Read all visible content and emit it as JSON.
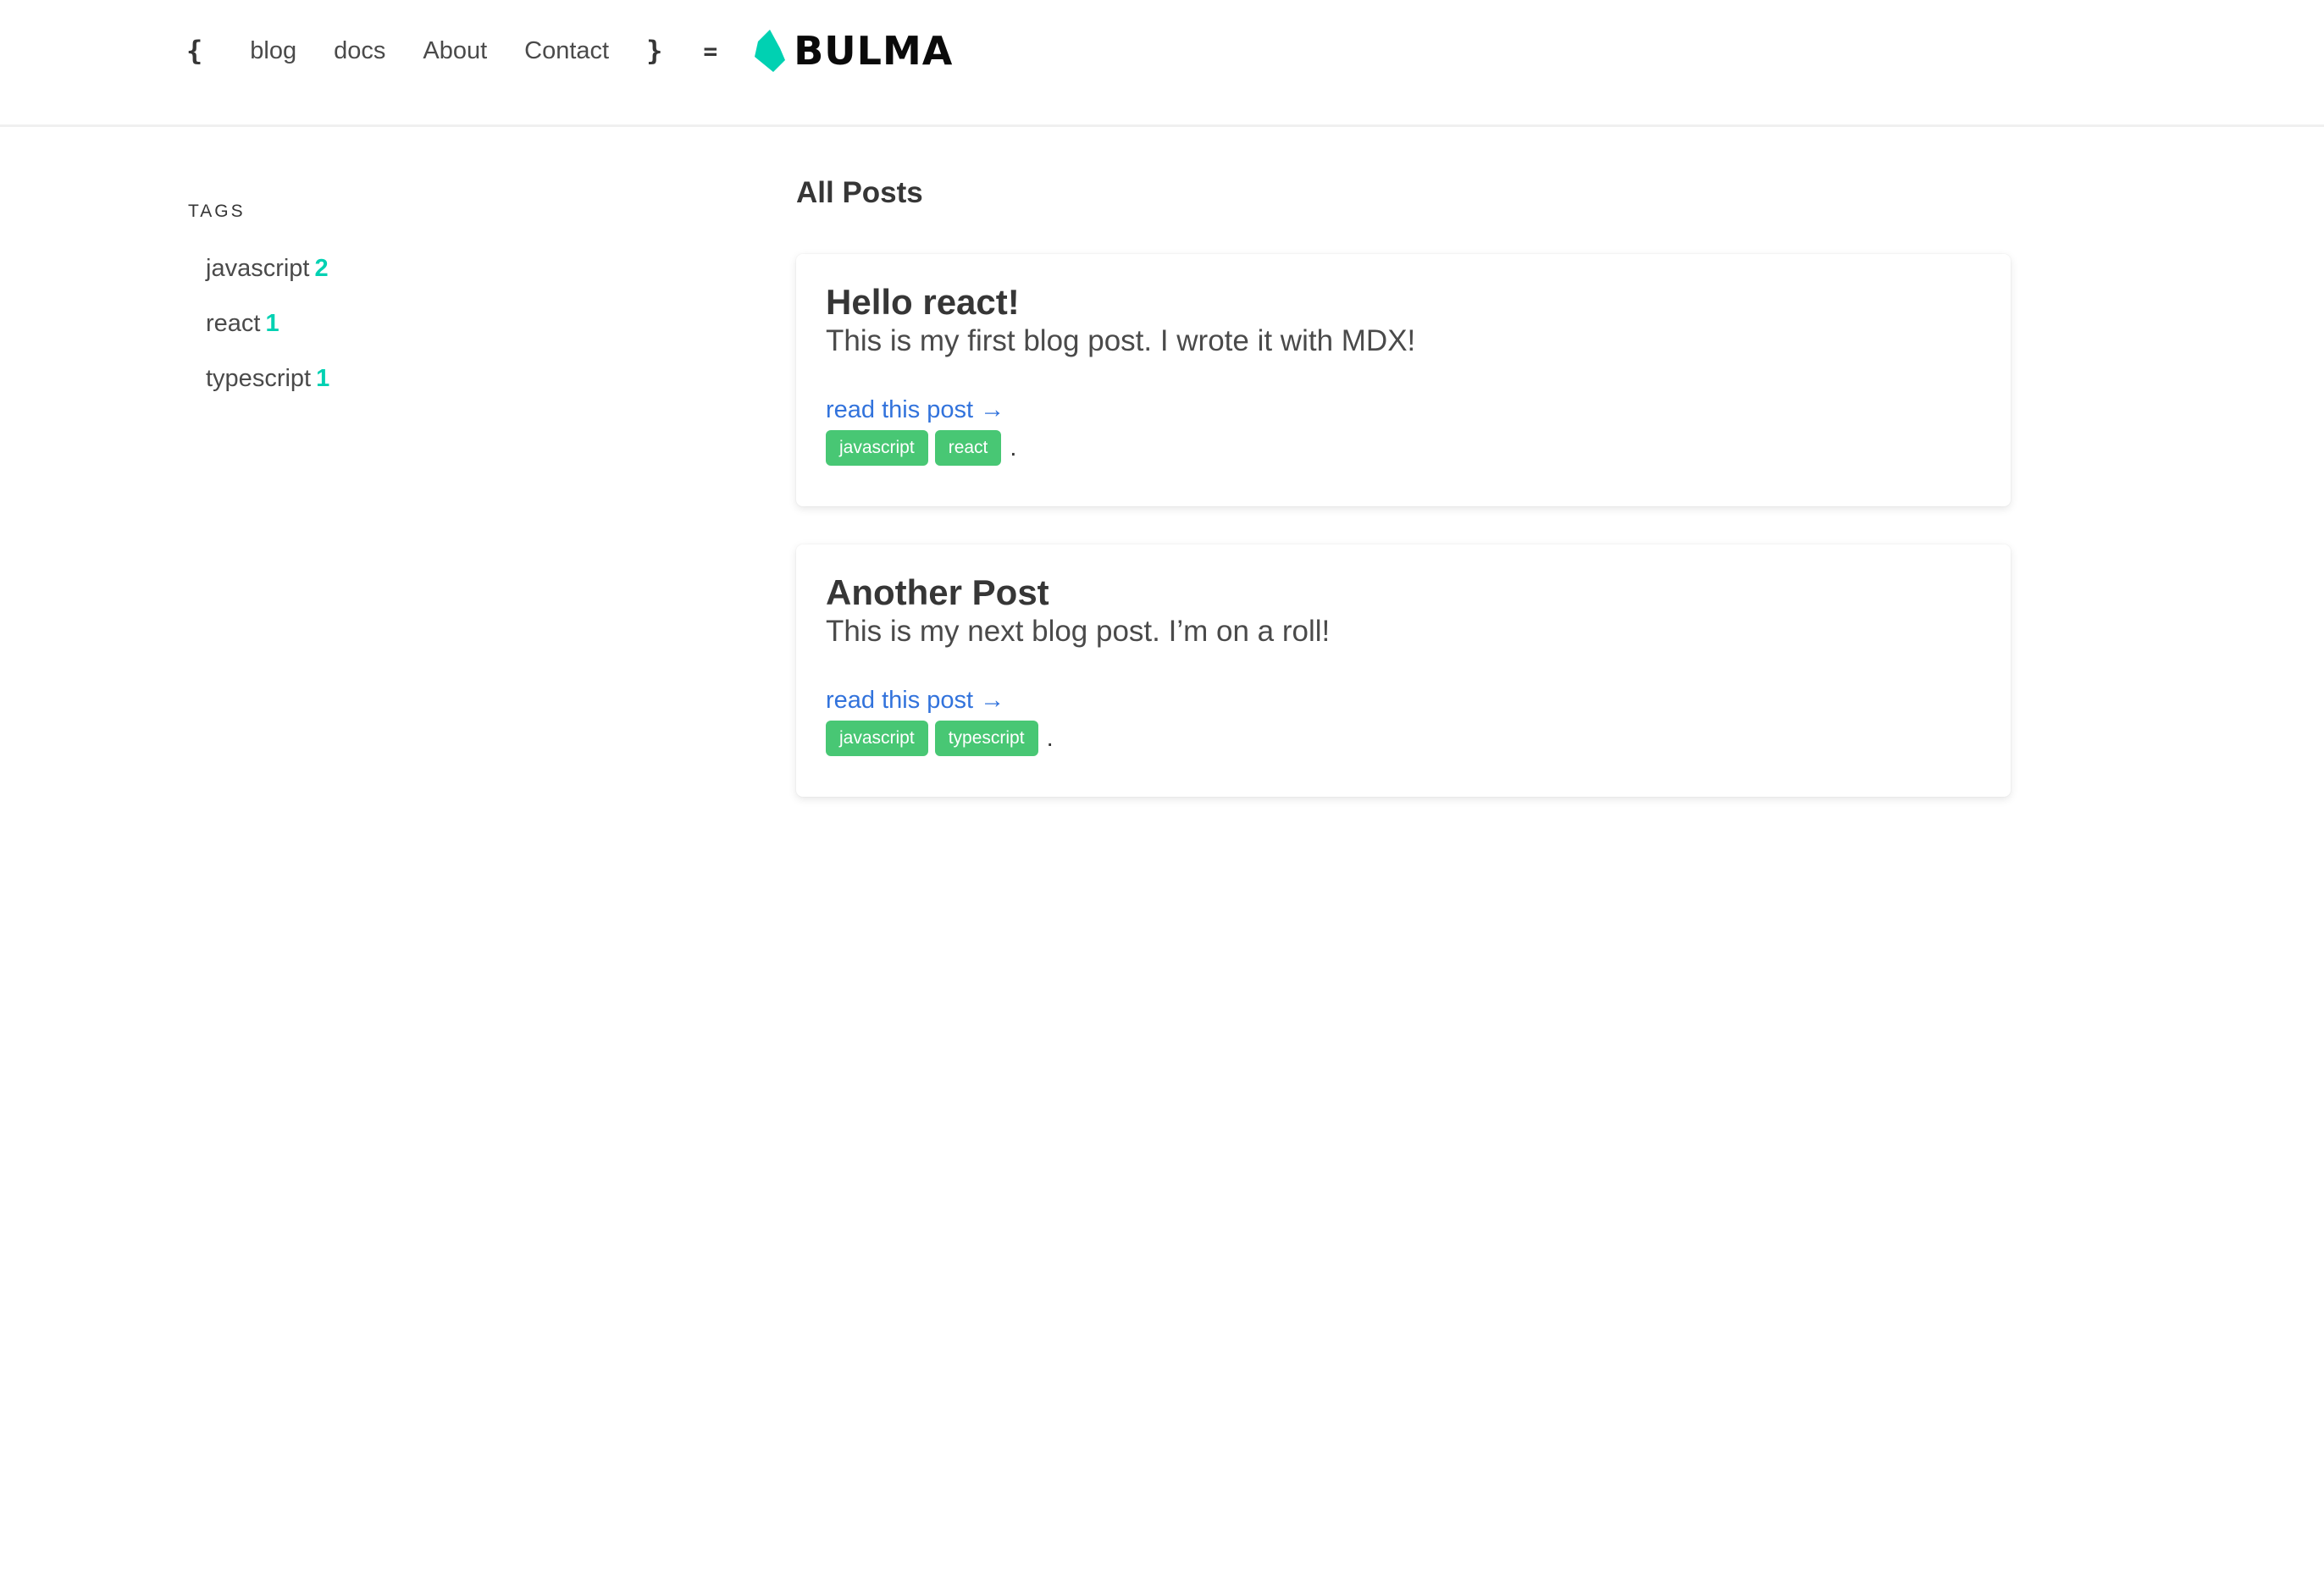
{
  "navbar": {
    "open_brace": "{",
    "close_brace": "}",
    "equals": "=",
    "items": [
      {
        "label": "blog"
      },
      {
        "label": "docs"
      },
      {
        "label": "About"
      },
      {
        "label": "Contact"
      }
    ],
    "logo_text": "BULMA",
    "logo_color": "#00d1b2"
  },
  "sidebar": {
    "heading": "TAGS",
    "tags": [
      {
        "name": "javascript",
        "count": "2"
      },
      {
        "name": "react",
        "count": "1"
      },
      {
        "name": "typescript",
        "count": "1"
      }
    ]
  },
  "main": {
    "title": "All Posts",
    "posts": [
      {
        "title": "Hello react!",
        "excerpt": "This is my first blog post. I wrote it with MDX!",
        "link": "read this post →",
        "tags": [
          "javascript",
          "react"
        ],
        "trailing": "."
      },
      {
        "title": "Another Post",
        "excerpt": "This is my next blog post. I’m on a roll!",
        "link": "read this post →",
        "tags": [
          "javascript",
          "typescript"
        ],
        "trailing": "."
      }
    ]
  },
  "colors": {
    "accent": "#00d1b2",
    "link": "#3273dc",
    "tag_bg": "#48c774"
  }
}
